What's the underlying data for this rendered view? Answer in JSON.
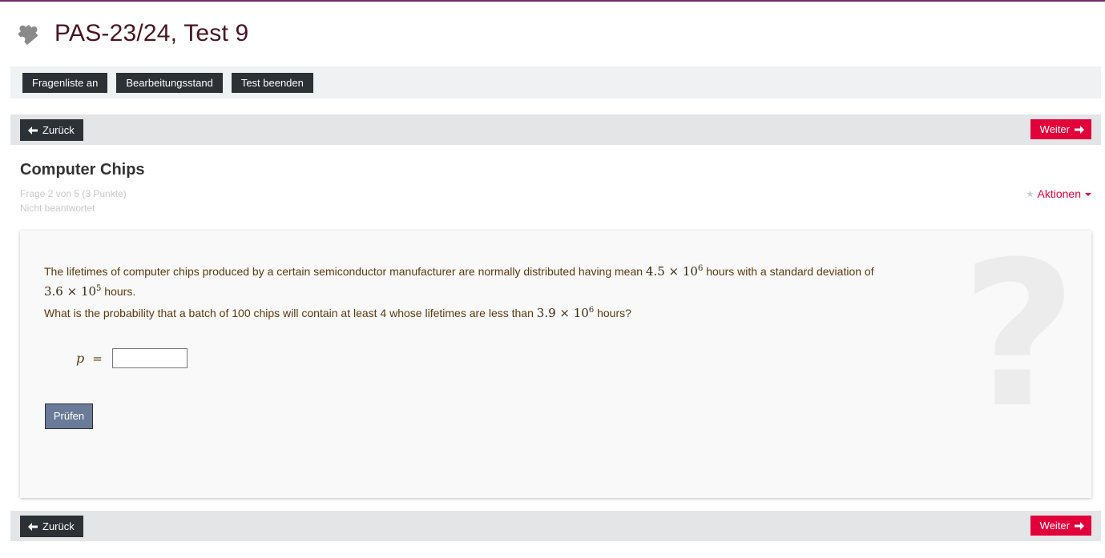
{
  "header": {
    "title": "PAS-23/24, Test 9",
    "icon": "puzzle-icon"
  },
  "toolbar": {
    "question_list": "Fragenliste an",
    "progress": "Bearbeitungsstand",
    "finish": "Test beenden"
  },
  "nav": {
    "back": "Zurück",
    "next": "Weiter"
  },
  "question": {
    "title": "Computer Chips",
    "position": "Frage 2 von 5 (3 Punkte)",
    "status": "Nicht beantwortet",
    "actions": "Aktionen",
    "text1_a": "The lifetimes of computer chips produced by a certain semiconductor manufacturer are normally distributed having mean ",
    "mean_base": "4.5 × 10",
    "mean_exp": "6",
    "text1_b": " hours with a standard deviation of ",
    "sd_base": "3.6 × 10",
    "sd_exp": "5",
    "text1_c": " hours.",
    "text2_a": "What is the probability that a batch of 100 chips will contain at least 4 whose lifetimes are less than ",
    "lim_base": "3.9 × 10",
    "lim_exp": "6",
    "text2_b": " hours?",
    "variable": "p",
    "equals": "=",
    "answer_value": "",
    "check": "Prüfen"
  },
  "colors": {
    "accent": "#e2003b",
    "dark": "#2b3135",
    "title": "#4a1420",
    "check": "#6a7b9a"
  }
}
